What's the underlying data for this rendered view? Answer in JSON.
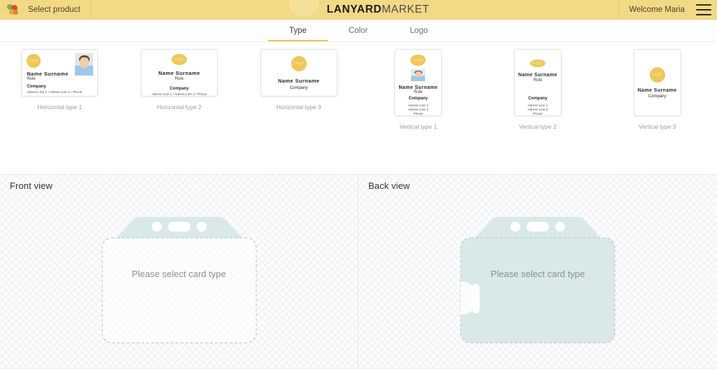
{
  "header": {
    "logo_icon": "grapes-icon",
    "select_product_label": "Select product",
    "brand_bold": "LANYARD",
    "brand_light": "MARKET",
    "welcome_label": "Welcome Maria",
    "menu_icon": "hamburger-menu-icon",
    "bar_color": "#f2d985"
  },
  "tabs": {
    "items": [
      {
        "label": "Type",
        "active": true
      },
      {
        "label": "Color",
        "active": false
      },
      {
        "label": "Logo",
        "active": false
      }
    ],
    "accent_color": "#e8c65a"
  },
  "card_types": {
    "logo_label": "Logo",
    "name_label": "Name  Surname",
    "role_label": "Role",
    "company_label": "Company",
    "address_inline": "Adress Line 1 / Adress Line 2 / Phone",
    "address_line1": "Adress Line 1",
    "address_line2": "Adress Line 2",
    "phone_label": "Phone",
    "items": [
      {
        "caption": "Horizontal type 1",
        "orientation": "horizontal",
        "has_photo": true
      },
      {
        "caption": "Horizontal type 2",
        "orientation": "horizontal",
        "has_photo": false
      },
      {
        "caption": "Horizontal type 3",
        "orientation": "horizontal",
        "has_photo": false
      },
      {
        "caption": "Vertical type 1",
        "orientation": "vertical",
        "has_photo": true
      },
      {
        "caption": "Vertical type 2",
        "orientation": "vertical",
        "has_photo": false
      },
      {
        "caption": "Vertical type 3",
        "orientation": "vertical",
        "has_photo": false
      }
    ]
  },
  "previews": {
    "front": {
      "title": "Front view",
      "placeholder": "Please select card type"
    },
    "back": {
      "title": "Back view",
      "placeholder": "Please select card type"
    },
    "holder_color": "#d8e9e7",
    "outline_color": "#b9d6d4"
  }
}
